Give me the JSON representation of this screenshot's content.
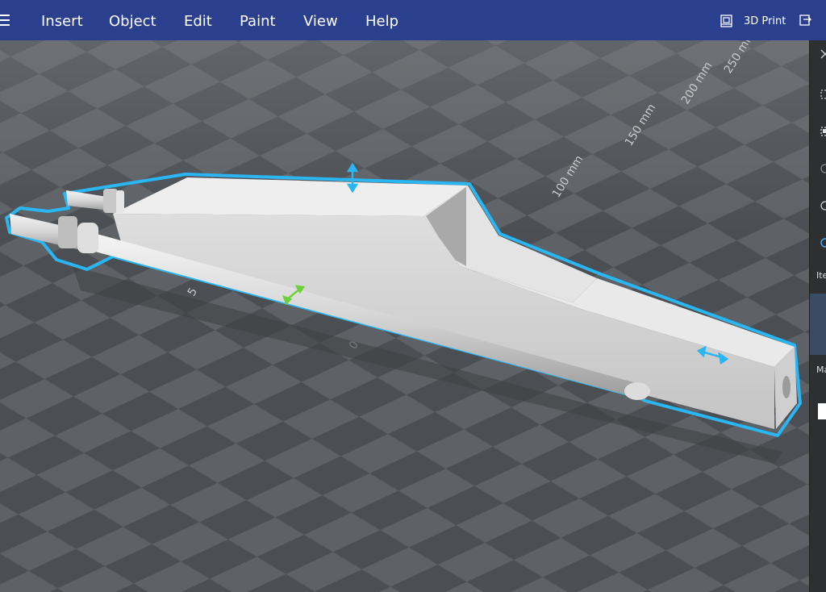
{
  "menubar": {
    "items": [
      {
        "label": "Insert"
      },
      {
        "label": "Object"
      },
      {
        "label": "Edit"
      },
      {
        "label": "Paint"
      },
      {
        "label": "View"
      },
      {
        "label": "Help"
      }
    ],
    "print_label": "3D Print",
    "menu_icon": "hamburger-icon",
    "print_icon": "printer-3d-icon",
    "share_icon": "share-icon"
  },
  "viewport": {
    "ruler_labels": [
      "250 mm",
      "200 mm",
      "150 mm",
      "100 mm",
      "5",
      "0"
    ],
    "selection_color": "#29b6f2",
    "rotate_handle_color": "#6fd13a"
  },
  "side_panel": {
    "items_label": "Ite",
    "material_label": "Ma"
  },
  "colors": {
    "menubar": "#2b3f8f",
    "grid_light": "#5f6266",
    "grid_dark": "#4b4e52"
  }
}
